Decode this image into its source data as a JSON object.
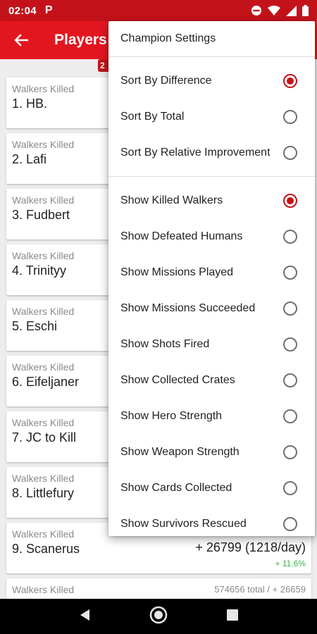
{
  "status_bar": {
    "time": "02:04",
    "notification_icon": "P",
    "icons": [
      "do-not-disturb-icon",
      "wifi-icon",
      "signal-icon",
      "battery-icon"
    ]
  },
  "app_bar": {
    "title": "Players",
    "badge": "2"
  },
  "players": [
    {
      "stat_label": "Walkers Killed",
      "name": "1. HB.",
      "total": "",
      "diff": "",
      "pct": ""
    },
    {
      "stat_label": "Walkers Killed",
      "name": "2. Lafi",
      "total": "",
      "diff": "",
      "pct": ""
    },
    {
      "stat_label": "Walkers Killed",
      "name": "3. Fudbert",
      "total": "",
      "diff": "",
      "pct": ""
    },
    {
      "stat_label": "Walkers Killed",
      "name": "4. Trinityy",
      "total": "",
      "diff": "",
      "pct": ""
    },
    {
      "stat_label": "Walkers Killed",
      "name": "5. Eschi",
      "total": "",
      "diff": "",
      "pct": ""
    },
    {
      "stat_label": "Walkers Killed",
      "name": "6. Eifeljaner",
      "total": "",
      "diff": "",
      "pct": ""
    },
    {
      "stat_label": "Walkers Killed",
      "name": "7. JC to Kill",
      "total": "",
      "diff": "",
      "pct": ""
    },
    {
      "stat_label": "Walkers Killed",
      "name": "8. Littlefury",
      "total": "",
      "diff": "",
      "pct": ""
    },
    {
      "stat_label": "Walkers Killed",
      "name": "9. Scanerus",
      "total": "",
      "diff": "+ 26799 (1218/day)",
      "pct": "+ 11.6%"
    },
    {
      "stat_label": "Walkers Killed",
      "name": "",
      "total": "574656 total / + 26659",
      "diff": "",
      "pct": ""
    }
  ],
  "menu": {
    "title": "Champion Settings",
    "sort_options": [
      {
        "label": "Sort By Difference",
        "checked": true
      },
      {
        "label": "Sort By Total",
        "checked": false
      },
      {
        "label": "Sort By Relative Improvement",
        "checked": false
      }
    ],
    "show_options": [
      {
        "label": "Show Killed Walkers",
        "checked": true
      },
      {
        "label": "Show Defeated Humans",
        "checked": false
      },
      {
        "label": "Show Missions Played",
        "checked": false
      },
      {
        "label": "Show Missions Succeeded",
        "checked": false
      },
      {
        "label": "Show Shots Fired",
        "checked": false
      },
      {
        "label": "Show Collected Crates",
        "checked": false
      },
      {
        "label": "Show Hero Strength",
        "checked": false
      },
      {
        "label": "Show Weapon Strength",
        "checked": false
      },
      {
        "label": "Show Cards Collected",
        "checked": false
      },
      {
        "label": "Show Survivors Rescued",
        "checked": false
      }
    ]
  },
  "colors": {
    "accent": "#e3161f",
    "status_bar": "#c4121a",
    "positive": "#3cb34a"
  }
}
